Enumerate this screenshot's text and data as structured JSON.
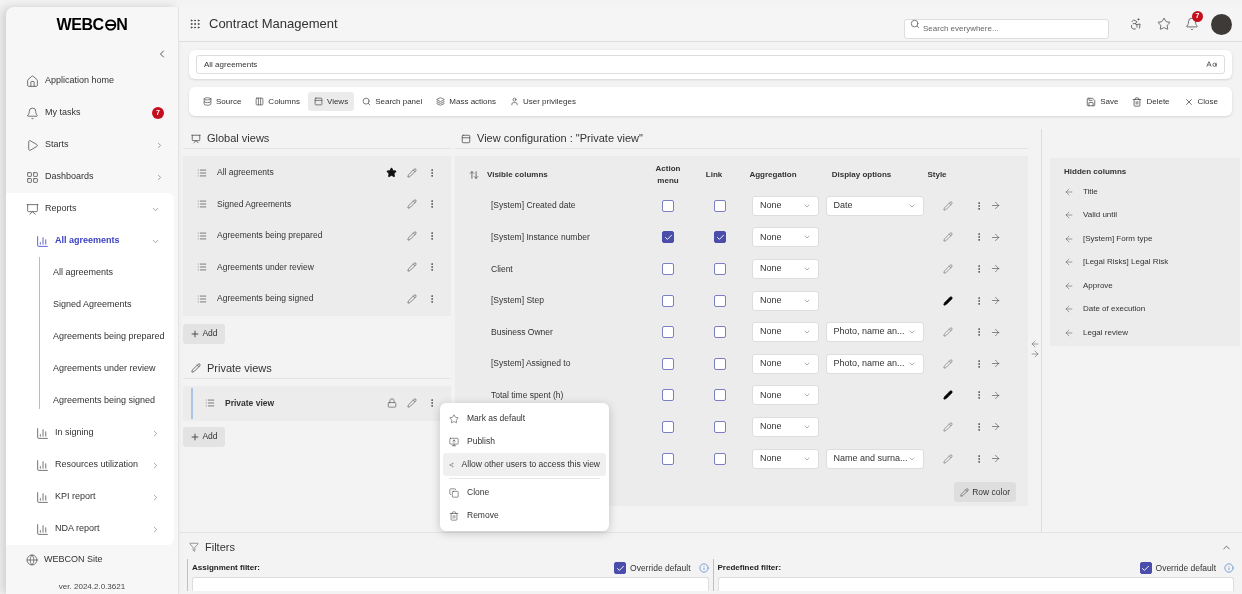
{
  "sidebar": {
    "logo": "WEBC⊖N",
    "items": [
      {
        "label": "Application home"
      },
      {
        "label": "My tasks",
        "badge": "7"
      },
      {
        "label": "Starts",
        "expanded": false
      },
      {
        "label": "Dashboards",
        "expanded": false
      },
      {
        "label": "Reports",
        "expanded": true,
        "children": [
          {
            "label": "All agreements",
            "expanded": true,
            "selected": true,
            "children": [
              {
                "label": "All agreements",
                "selected": false
              },
              {
                "label": "Signed Agreements",
                "selected": false
              },
              {
                "label": "Agreements being prepared",
                "selected": false
              },
              {
                "label": "Agreements under review",
                "selected": false
              },
              {
                "label": "Agreements being signed",
                "selected": false
              }
            ]
          },
          {
            "label": "In signing",
            "expanded": false,
            "selected": false
          },
          {
            "label": "Resources utilization",
            "expanded": false,
            "selected": false
          },
          {
            "label": "KPI report",
            "expanded": false,
            "selected": false
          },
          {
            "label": "NDA report",
            "expanded": false,
            "selected": false
          }
        ]
      }
    ],
    "footer_link": "WEBCON Site",
    "version": "ver. 2024.2.0.3621"
  },
  "header": {
    "app_title": "Contract Management",
    "search": {
      "placeholder": "Search everywhere..."
    },
    "notification_count": "7"
  },
  "report_field": {
    "value": "All agreements"
  },
  "toolbar": {
    "tabs": [
      {
        "label": "Source",
        "selected": false
      },
      {
        "label": "Columns",
        "selected": false
      },
      {
        "label": "Views",
        "selected": true
      },
      {
        "label": "Search panel",
        "selected": false
      },
      {
        "label": "Mass actions",
        "selected": false
      },
      {
        "label": "User privileges",
        "selected": false
      }
    ],
    "actions": [
      "Save",
      "Delete",
      "Close"
    ]
  },
  "global_views": {
    "title": "Global views",
    "items": [
      {
        "name": "All agreements",
        "default": true
      },
      {
        "name": "Signed Agreements",
        "default": false
      },
      {
        "name": "Agreements being prepared",
        "default": false
      },
      {
        "name": "Agreements under review",
        "default": false
      },
      {
        "name": "Agreements being signed",
        "default": false
      }
    ],
    "add_label": "Add"
  },
  "private_views": {
    "title": "Private views",
    "items": [
      {
        "name": "Private view",
        "selected": true,
        "locked": true
      }
    ],
    "add_label": "Add"
  },
  "view_configuration": {
    "title": "View configuration : \"Private view\"",
    "columns": [
      "Visible columns",
      "Action menu",
      "Link",
      "Aggregation",
      "Display options",
      "Style"
    ],
    "rows": [
      {
        "name": "[System] Created date",
        "action_menu": false,
        "link": false,
        "aggregation": "None",
        "display": "Date",
        "styled": false
      },
      {
        "name": "[System] Instance number",
        "action_menu": true,
        "link": true,
        "aggregation": "None",
        "styled": false
      },
      {
        "name": "Client",
        "action_menu": false,
        "link": false,
        "aggregation": "None",
        "styled": false
      },
      {
        "name": "[System] Step",
        "action_menu": false,
        "link": false,
        "aggregation": "None",
        "styled": true
      },
      {
        "name": "Business Owner",
        "action_menu": false,
        "link": false,
        "aggregation": "None",
        "display": "Photo, name an...",
        "styled": false
      },
      {
        "name": "[System] Assigned to",
        "action_menu": false,
        "link": false,
        "aggregation": "None",
        "display": "Photo, name an...",
        "styled": false
      },
      {
        "name": "Total time spent (h)",
        "action_menu": false,
        "link": false,
        "aggregation": "None",
        "styled": true
      },
      {
        "action_menu": false,
        "link": false,
        "aggregation": "None",
        "styled": false
      },
      {
        "action_menu": false,
        "link": false,
        "aggregation": "None",
        "display": "Name and surna...",
        "styled": false
      }
    ],
    "row_color_label": "Row color"
  },
  "hidden_columns": {
    "title": "Hidden columns",
    "items": [
      "Title",
      "Valid until",
      "[System] Form type",
      "[Legal Risks] Legal Risk",
      "Approve",
      "Date of execution",
      "Legal review"
    ]
  },
  "context_menu": {
    "items": [
      {
        "label": "Mark as default",
        "highlighted": false,
        "separator_before": false
      },
      {
        "label": "Publish",
        "highlighted": false,
        "separator_before": false
      },
      {
        "label": "Allow other users to access this view",
        "highlighted": true,
        "separator_before": false
      },
      {
        "label": "Clone",
        "highlighted": false,
        "separator_before": true
      },
      {
        "label": "Remove",
        "highlighted": false,
        "separator_before": false
      }
    ]
  },
  "filters": {
    "title": "Filters",
    "panels": [
      {
        "label": "Assignment filter:",
        "override_label": "Override default",
        "override": true
      },
      {
        "label": "Predefined filter:",
        "override_label": "Override default",
        "override": true
      }
    ]
  }
}
